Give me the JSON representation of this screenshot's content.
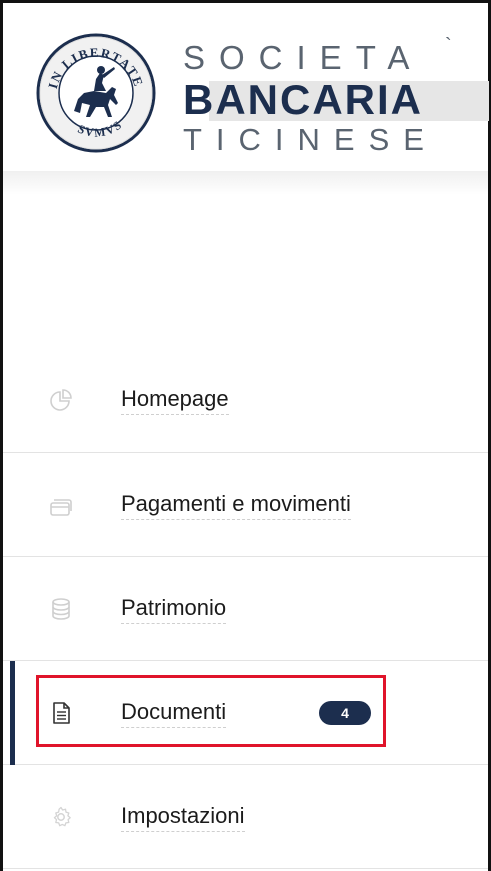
{
  "logo": {
    "line1": "SOCIETA",
    "line1_accent": "`",
    "line2": "BANCARIA",
    "line3": "TICINESE",
    "seal_text_top": "IN LIBERTATE",
    "seal_text_bottom": "SVMVS",
    "seal_icon": "horse-rider-seal-icon"
  },
  "colors": {
    "brand_navy": "#1c2e4e",
    "highlight_red": "#e0142a",
    "icon_gray": "#c9c9c9"
  },
  "nav": {
    "items": [
      {
        "label": "Homepage",
        "icon": "pie-chart-icon"
      },
      {
        "label": "Pagamenti e movimenti",
        "icon": "cards-icon"
      },
      {
        "label": "Patrimonio",
        "icon": "database-icon"
      },
      {
        "label": "Documenti",
        "icon": "document-icon",
        "badge": "4",
        "active": true
      },
      {
        "label": "Impostazioni",
        "icon": "gear-icon"
      }
    ]
  }
}
